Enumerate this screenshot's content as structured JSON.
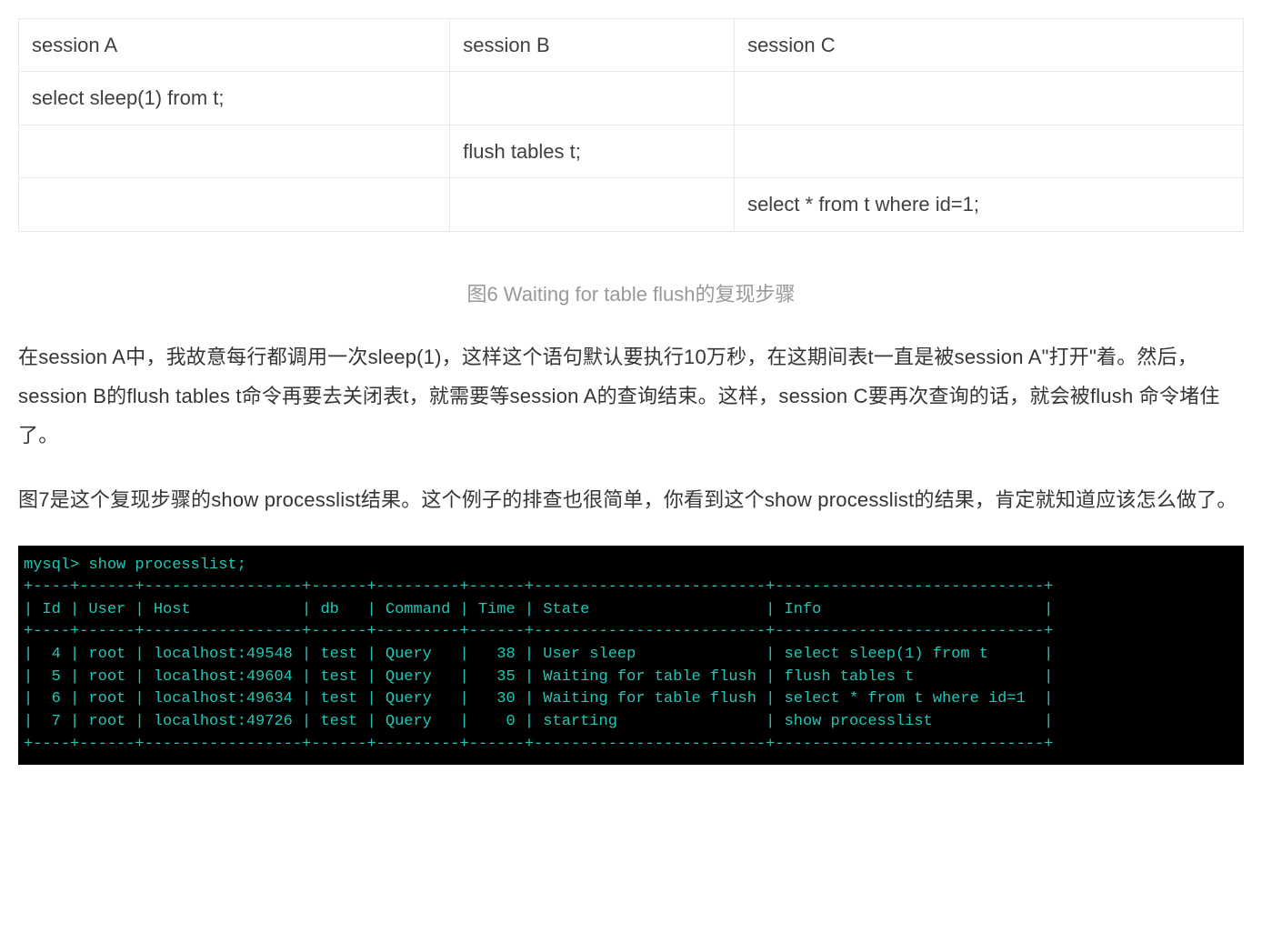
{
  "sessions_table": {
    "headers": [
      "session A",
      "session B",
      "session C"
    ],
    "rows": [
      [
        "select sleep(1) from t;",
        "",
        ""
      ],
      [
        "",
        "flush tables t;",
        ""
      ],
      [
        "",
        "",
        "select * from t where id=1;"
      ]
    ]
  },
  "fig6_caption": "图6 Waiting for table flush的复现步骤",
  "paragraph1": "在session A中，我故意每行都调用一次sleep(1)，这样这个语句默认要执行10万秒，在这期间表t一直是被session A\"打开\"着。然后，session B的flush tables t命令再要去关闭表t，就需要等session A的查询结束。这样，session C要再次查询的话，就会被flush 命令堵住了。",
  "paragraph2": "图7是这个复现步骤的show processlist结果。这个例子的排查也很简单，你看到这个show processlist的结果，肯定就知道应该怎么做了。",
  "terminal": {
    "prompt": "mysql> show processlist;",
    "sep": "+----+------+-----------------+------+---------+------+-------------------------+-----------------------------+",
    "header": "| Id | User | Host            | db   | Command | Time | State                   | Info                        |",
    "rows": [
      "|  4 | root | localhost:49548 | test | Query   |   38 | User sleep              | select sleep(1) from t      |",
      "|  5 | root | localhost:49604 | test | Query   |   35 | Waiting for table flush | flush tables t              |",
      "|  6 | root | localhost:49634 | test | Query   |   30 | Waiting for table flush | select * from t where id=1  |",
      "|  7 | root | localhost:49726 | test | Query   |    0 | starting                | show processlist            |"
    ]
  },
  "chart_data": {
    "type": "table",
    "title": "show processlist",
    "columns": [
      "Id",
      "User",
      "Host",
      "db",
      "Command",
      "Time",
      "State",
      "Info"
    ],
    "rows": [
      [
        4,
        "root",
        "localhost:49548",
        "test",
        "Query",
        38,
        "User sleep",
        "select sleep(1) from t"
      ],
      [
        5,
        "root",
        "localhost:49604",
        "test",
        "Query",
        35,
        "Waiting for table flush",
        "flush tables t"
      ],
      [
        6,
        "root",
        "localhost:49634",
        "test",
        "Query",
        30,
        "Waiting for table flush",
        "select * from t where id=1"
      ],
      [
        7,
        "root",
        "localhost:49726",
        "test",
        "Query",
        0,
        "starting",
        "show processlist"
      ]
    ]
  }
}
